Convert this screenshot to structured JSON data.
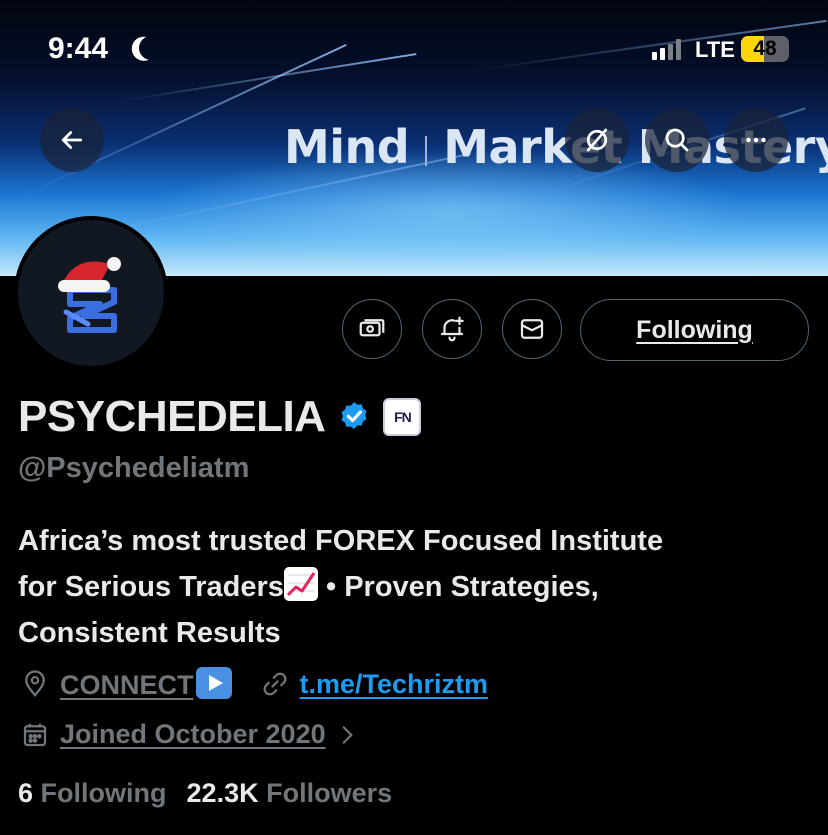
{
  "status_bar": {
    "time": "9:44",
    "network": "LTE",
    "battery": "48",
    "battery_level": 0.48,
    "signal_bars_active": 2
  },
  "banner": {
    "text_left": "Mind",
    "text_middle": "Market",
    "text_right": "Mastery"
  },
  "nav": {
    "back_icon": "arrow-left-icon",
    "grok_icon": "slash-circle-icon",
    "search_icon": "search-icon",
    "more_icon": "more-horizontal-icon"
  },
  "actions": {
    "tip_icon": "money-icon",
    "notify_icon": "bell-plus-icon",
    "message_icon": "envelope-icon",
    "following_label": "Following"
  },
  "profile": {
    "display_name": "PSYCHEDELIA",
    "affiliate_badge": "FN",
    "handle": "@Psychedeliatm",
    "bio_line1": "Africa’s most trusted FOREX Focused Institute",
    "bio_line2_a": "for Serious Traders",
    "bio_line2_b": " • Proven Strategies,",
    "bio_line3": "Consistent Results",
    "location": "CONNECT",
    "website": "t.me/Techriztm",
    "joined": "Joined October 2020",
    "following_count": "6",
    "following_label": "Following",
    "followers_count": "22.3K",
    "followers_label": "Followers"
  },
  "colors": {
    "accent_blue": "#1d9bf0",
    "muted_text": "#71767b",
    "primary_text": "#e7e9ea",
    "background": "#000000",
    "border": "#536471",
    "battery_yellow": "#ffd60a"
  }
}
